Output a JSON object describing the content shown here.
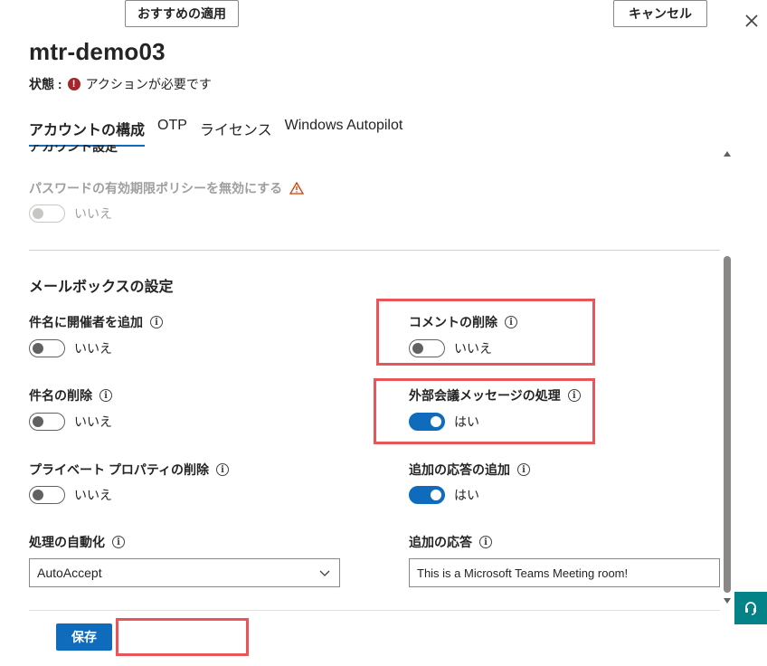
{
  "header": {
    "title": "mtr-demo03",
    "status_label": "状態 :",
    "status_text": "アクションが必要です"
  },
  "tabs": [
    {
      "label": "アカウントの構成",
      "active": true
    },
    {
      "label": "OTP",
      "active": false
    },
    {
      "label": "ライセンス",
      "active": false
    },
    {
      "label": "Windows Autopilot",
      "active": false
    }
  ],
  "account_settings": {
    "section_title": "アカウント設定",
    "password_policy_label": "パスワードの有効期限ポリシーを無効にする",
    "password_policy_value": "いいえ"
  },
  "mailbox": {
    "section_title": "メールボックスの設定",
    "add_organizer_label": "件名に開催者を追加",
    "add_organizer_value": "いいえ",
    "delete_comments_label": "コメントの削除",
    "delete_comments_value": "いいえ",
    "delete_subject_label": "件名の削除",
    "delete_subject_value": "いいえ",
    "process_external_label": "外部会議メッセージの処理",
    "process_external_value": "はい",
    "delete_private_label": "プライベート プロパティの削除",
    "delete_private_value": "いいえ",
    "add_additional_response_label": "追加の応答の追加",
    "add_additional_response_value": "はい",
    "automate_processing_label": "処理の自動化",
    "automate_processing_value": "AutoAccept",
    "additional_response_label": "追加の応答",
    "additional_response_value": "This is a Microsoft Teams Meeting room!"
  },
  "footer": {
    "save_label": "保存",
    "apply_recommended_label": "おすすめの適用",
    "cancel_label": "キャンセル"
  },
  "colors": {
    "accent": "#0f6cbd",
    "highlight": "#e8555a",
    "error": "#a4262c",
    "warning": "#d83b01",
    "help_fab": "#038387"
  },
  "icons": {
    "close": "close-icon",
    "status": "error-icon",
    "warning": "warning-icon",
    "info": "info-icon",
    "help": "help-headset-icon"
  }
}
